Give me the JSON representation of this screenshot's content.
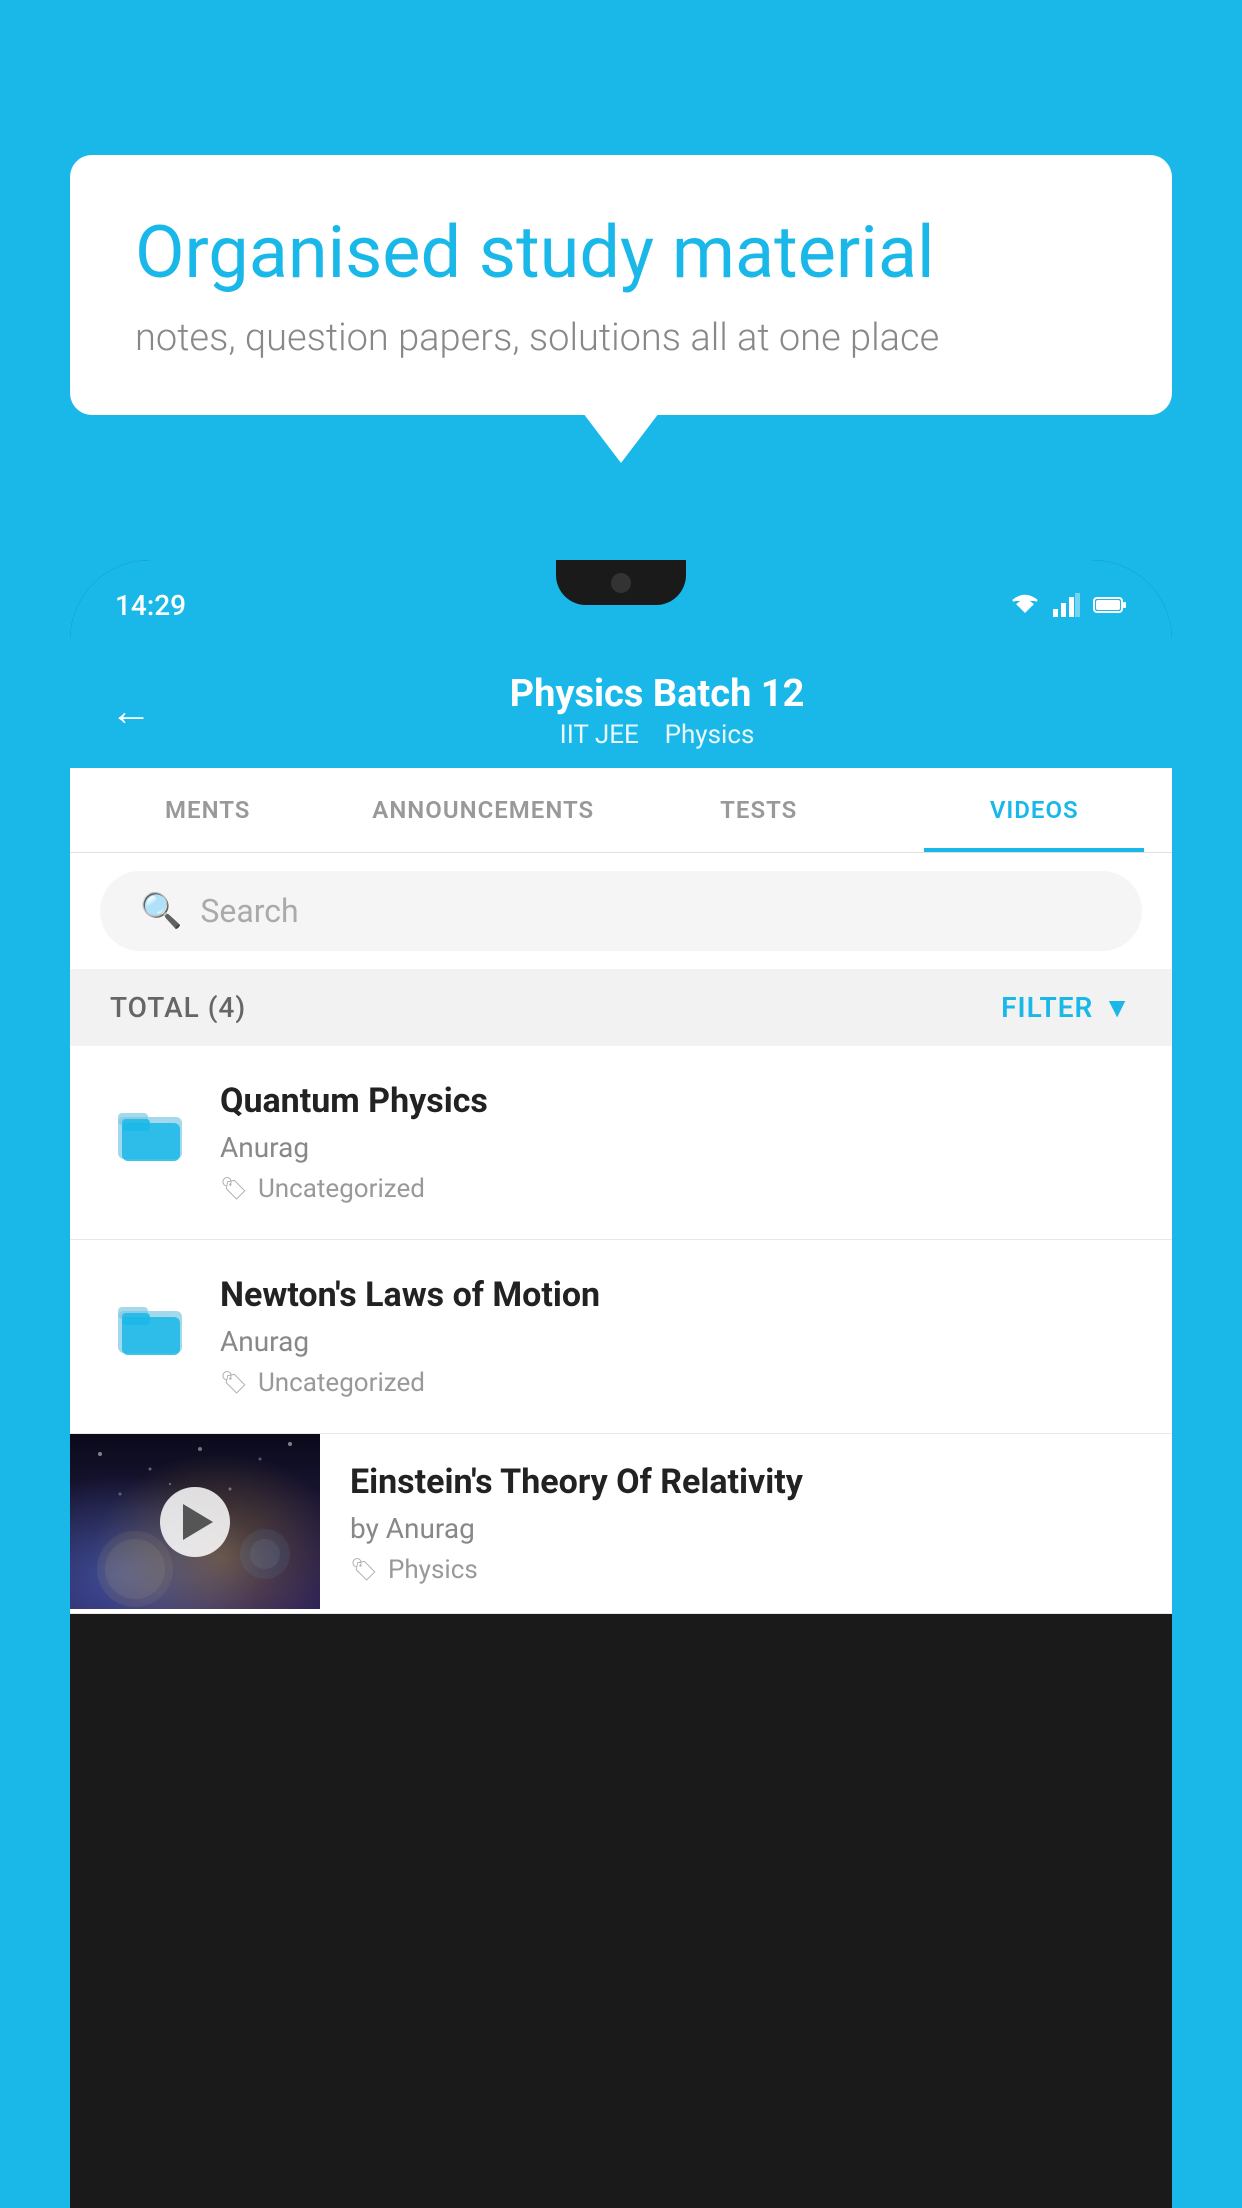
{
  "background_color": "#1ab8e8",
  "speech_bubble": {
    "title": "Organised study material",
    "subtitle": "notes, question papers, solutions all at one place"
  },
  "phone": {
    "status_bar": {
      "time": "14:29"
    },
    "header": {
      "back_label": "←",
      "title": "Physics Batch 12",
      "subtitle_parts": [
        "IIT JEE",
        "Physics"
      ]
    },
    "tabs": [
      {
        "label": "MENTS",
        "active": false
      },
      {
        "label": "ANNOUNCEMENTS",
        "active": false
      },
      {
        "label": "TESTS",
        "active": false
      },
      {
        "label": "VIDEOS",
        "active": true
      }
    ],
    "search": {
      "placeholder": "Search"
    },
    "filter_bar": {
      "total_label": "TOTAL (4)",
      "filter_label": "FILTER"
    },
    "videos": [
      {
        "type": "folder",
        "title": "Quantum Physics",
        "author": "Anurag",
        "tag": "Uncategorized"
      },
      {
        "type": "folder",
        "title": "Newton's Laws of Motion",
        "author": "Anurag",
        "tag": "Uncategorized"
      },
      {
        "type": "video",
        "title": "Einstein's Theory Of Relativity",
        "author": "by Anurag",
        "tag": "Physics"
      }
    ]
  }
}
